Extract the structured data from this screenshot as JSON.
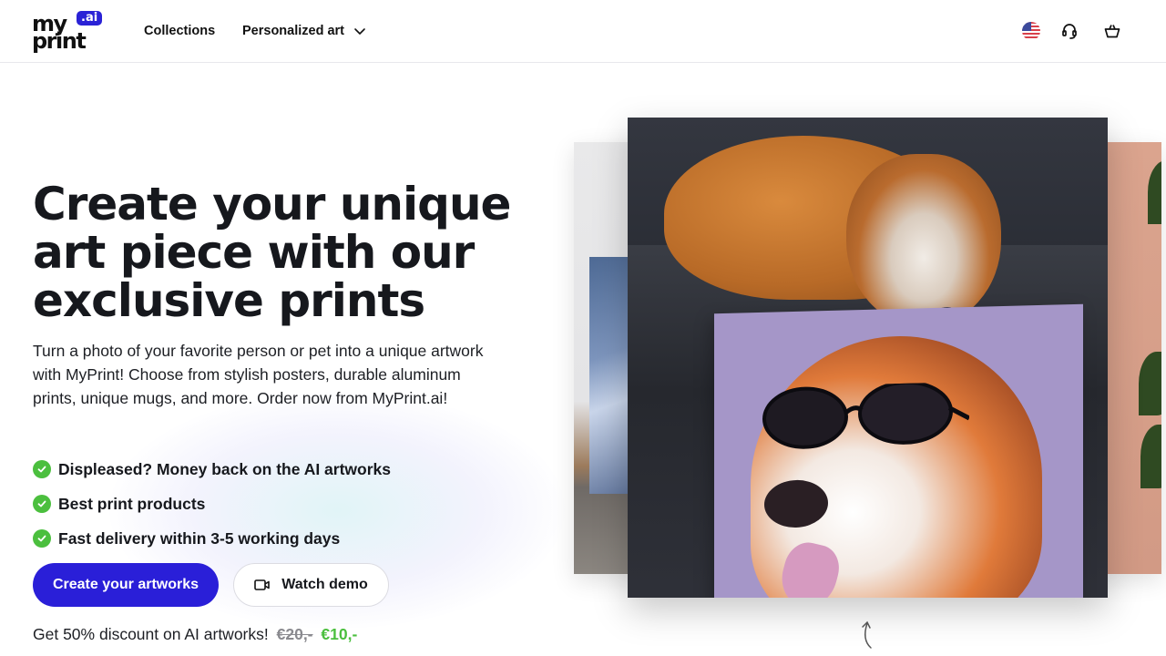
{
  "header": {
    "logo": {
      "line1": "my",
      "line2": "print",
      "badge": ".ai"
    },
    "nav": [
      {
        "label": "Collections"
      },
      {
        "label": "Personalized art",
        "has_dropdown": true
      }
    ],
    "icons": [
      "us-flag-icon",
      "headset-support-icon",
      "shopping-basket-icon"
    ]
  },
  "hero": {
    "headline": "Create your unique art piece with our exclusive prints",
    "description": "Turn a photo of your favorite person or pet into a unique artwork with MyPrint! Choose from stylish posters, durable aluminum prints, unique mugs, and more. Order now from MyPrint.ai!",
    "bullets": [
      {
        "text": "Displeased? Money back on the AI artworks"
      },
      {
        "text": "Best print products"
      },
      {
        "text": "Fast delivery within 3-5 working days"
      }
    ],
    "primary_button": "Create your artworks",
    "secondary_button": "Watch demo",
    "promo": {
      "text": "Get 50% discount on AI artworks!",
      "old_price": "€20,-",
      "new_price": "€10,-"
    }
  },
  "colors": {
    "brand": "#2a1fd8",
    "check": "#4bbf3e",
    "text": "#16181d"
  }
}
